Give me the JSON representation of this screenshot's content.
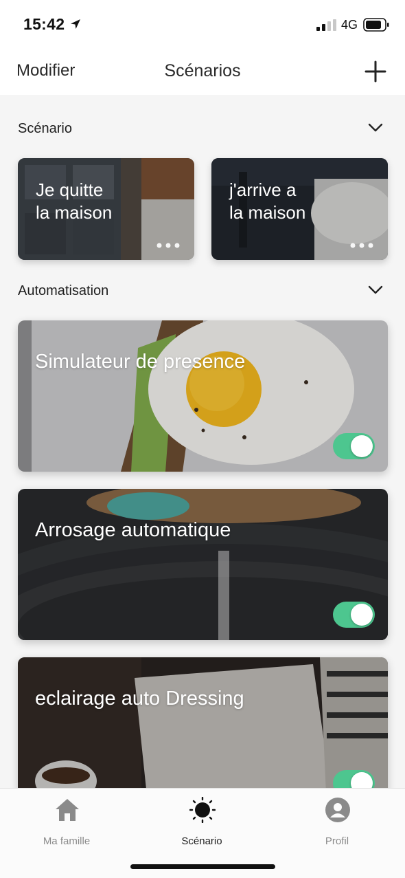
{
  "status_bar": {
    "time": "15:42",
    "network": "4G",
    "icons": [
      "location-arrow-icon",
      "signal-icon",
      "battery-icon"
    ]
  },
  "nav": {
    "edit_label": "Modifier",
    "title": "Scénarios",
    "add_icon": "plus-icon"
  },
  "sections": {
    "scenario": {
      "title": "Scénario",
      "icon": "chevron-down-icon"
    },
    "automation": {
      "title": "Automatisation",
      "icon": "chevron-down-icon"
    }
  },
  "scenarios": [
    {
      "line1": "Je quitte",
      "line2": "la maison",
      "more_icon": "more-dots-icon"
    },
    {
      "line1": "j'arrive a",
      "line2": "la maison",
      "more_icon": "more-dots-icon"
    }
  ],
  "automations": [
    {
      "title": "Simulateur de presence",
      "enabled": true
    },
    {
      "title": "Arrosage automatique",
      "enabled": true
    },
    {
      "title": "eclairage auto Dressing",
      "enabled": true
    }
  ],
  "tabs": [
    {
      "label": "Ma famille",
      "icon": "home-icon",
      "active": false
    },
    {
      "label": "Scénario",
      "icon": "sun-icon",
      "active": true
    },
    {
      "label": "Profil",
      "icon": "profile-icon",
      "active": false
    }
  ],
  "colors": {
    "toggle_on": "#4dc68f",
    "background": "#f5f5f5"
  }
}
